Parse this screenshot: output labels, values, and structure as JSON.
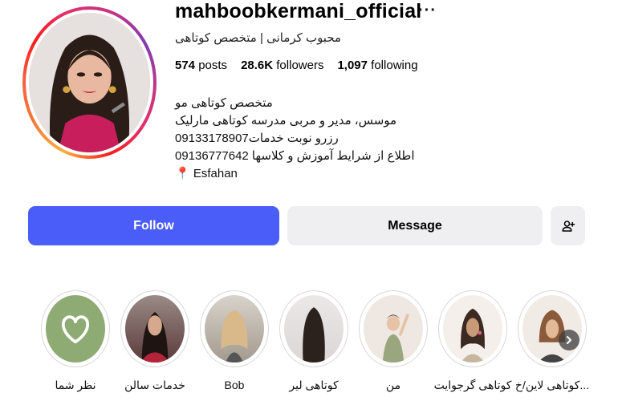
{
  "profile": {
    "username": "mahboobkermani_official",
    "more_icon": "more-horizontal-icon",
    "full_name": "محبوب کرمانی | متخصص کوتاهی",
    "stats": {
      "posts_count": "574",
      "posts_label": "posts",
      "followers_count": "28.6K",
      "followers_label": "followers",
      "following_count": "1,097",
      "following_label": "following"
    },
    "bio": [
      "متخصص کوتاهی مو",
      "موسس، مدیر و مربی مدرسه کوتاهی مارلیک",
      "رزرو نوبت خدمات09133178907",
      "اطلاع از شرایط آموزش و کلاسها 09136777642",
      "📍 Esfahan"
    ]
  },
  "actions": {
    "follow_label": "Follow",
    "message_label": "Message",
    "add_user_icon": "person-add-icon",
    "follow_color": "#4a5df9"
  },
  "highlights": [
    {
      "label": "نظر شما",
      "icon": "heart-icon"
    },
    {
      "label": "خدمات سالن"
    },
    {
      "label": "Bob"
    },
    {
      "label": "کوتاهی لیر"
    },
    {
      "label": "من"
    },
    {
      "label": "کوتاهی گرجوایت"
    },
    {
      "label": "کوتاهی لاین/خ..."
    }
  ],
  "navigation": {
    "next_icon": "chevron-right-icon"
  }
}
